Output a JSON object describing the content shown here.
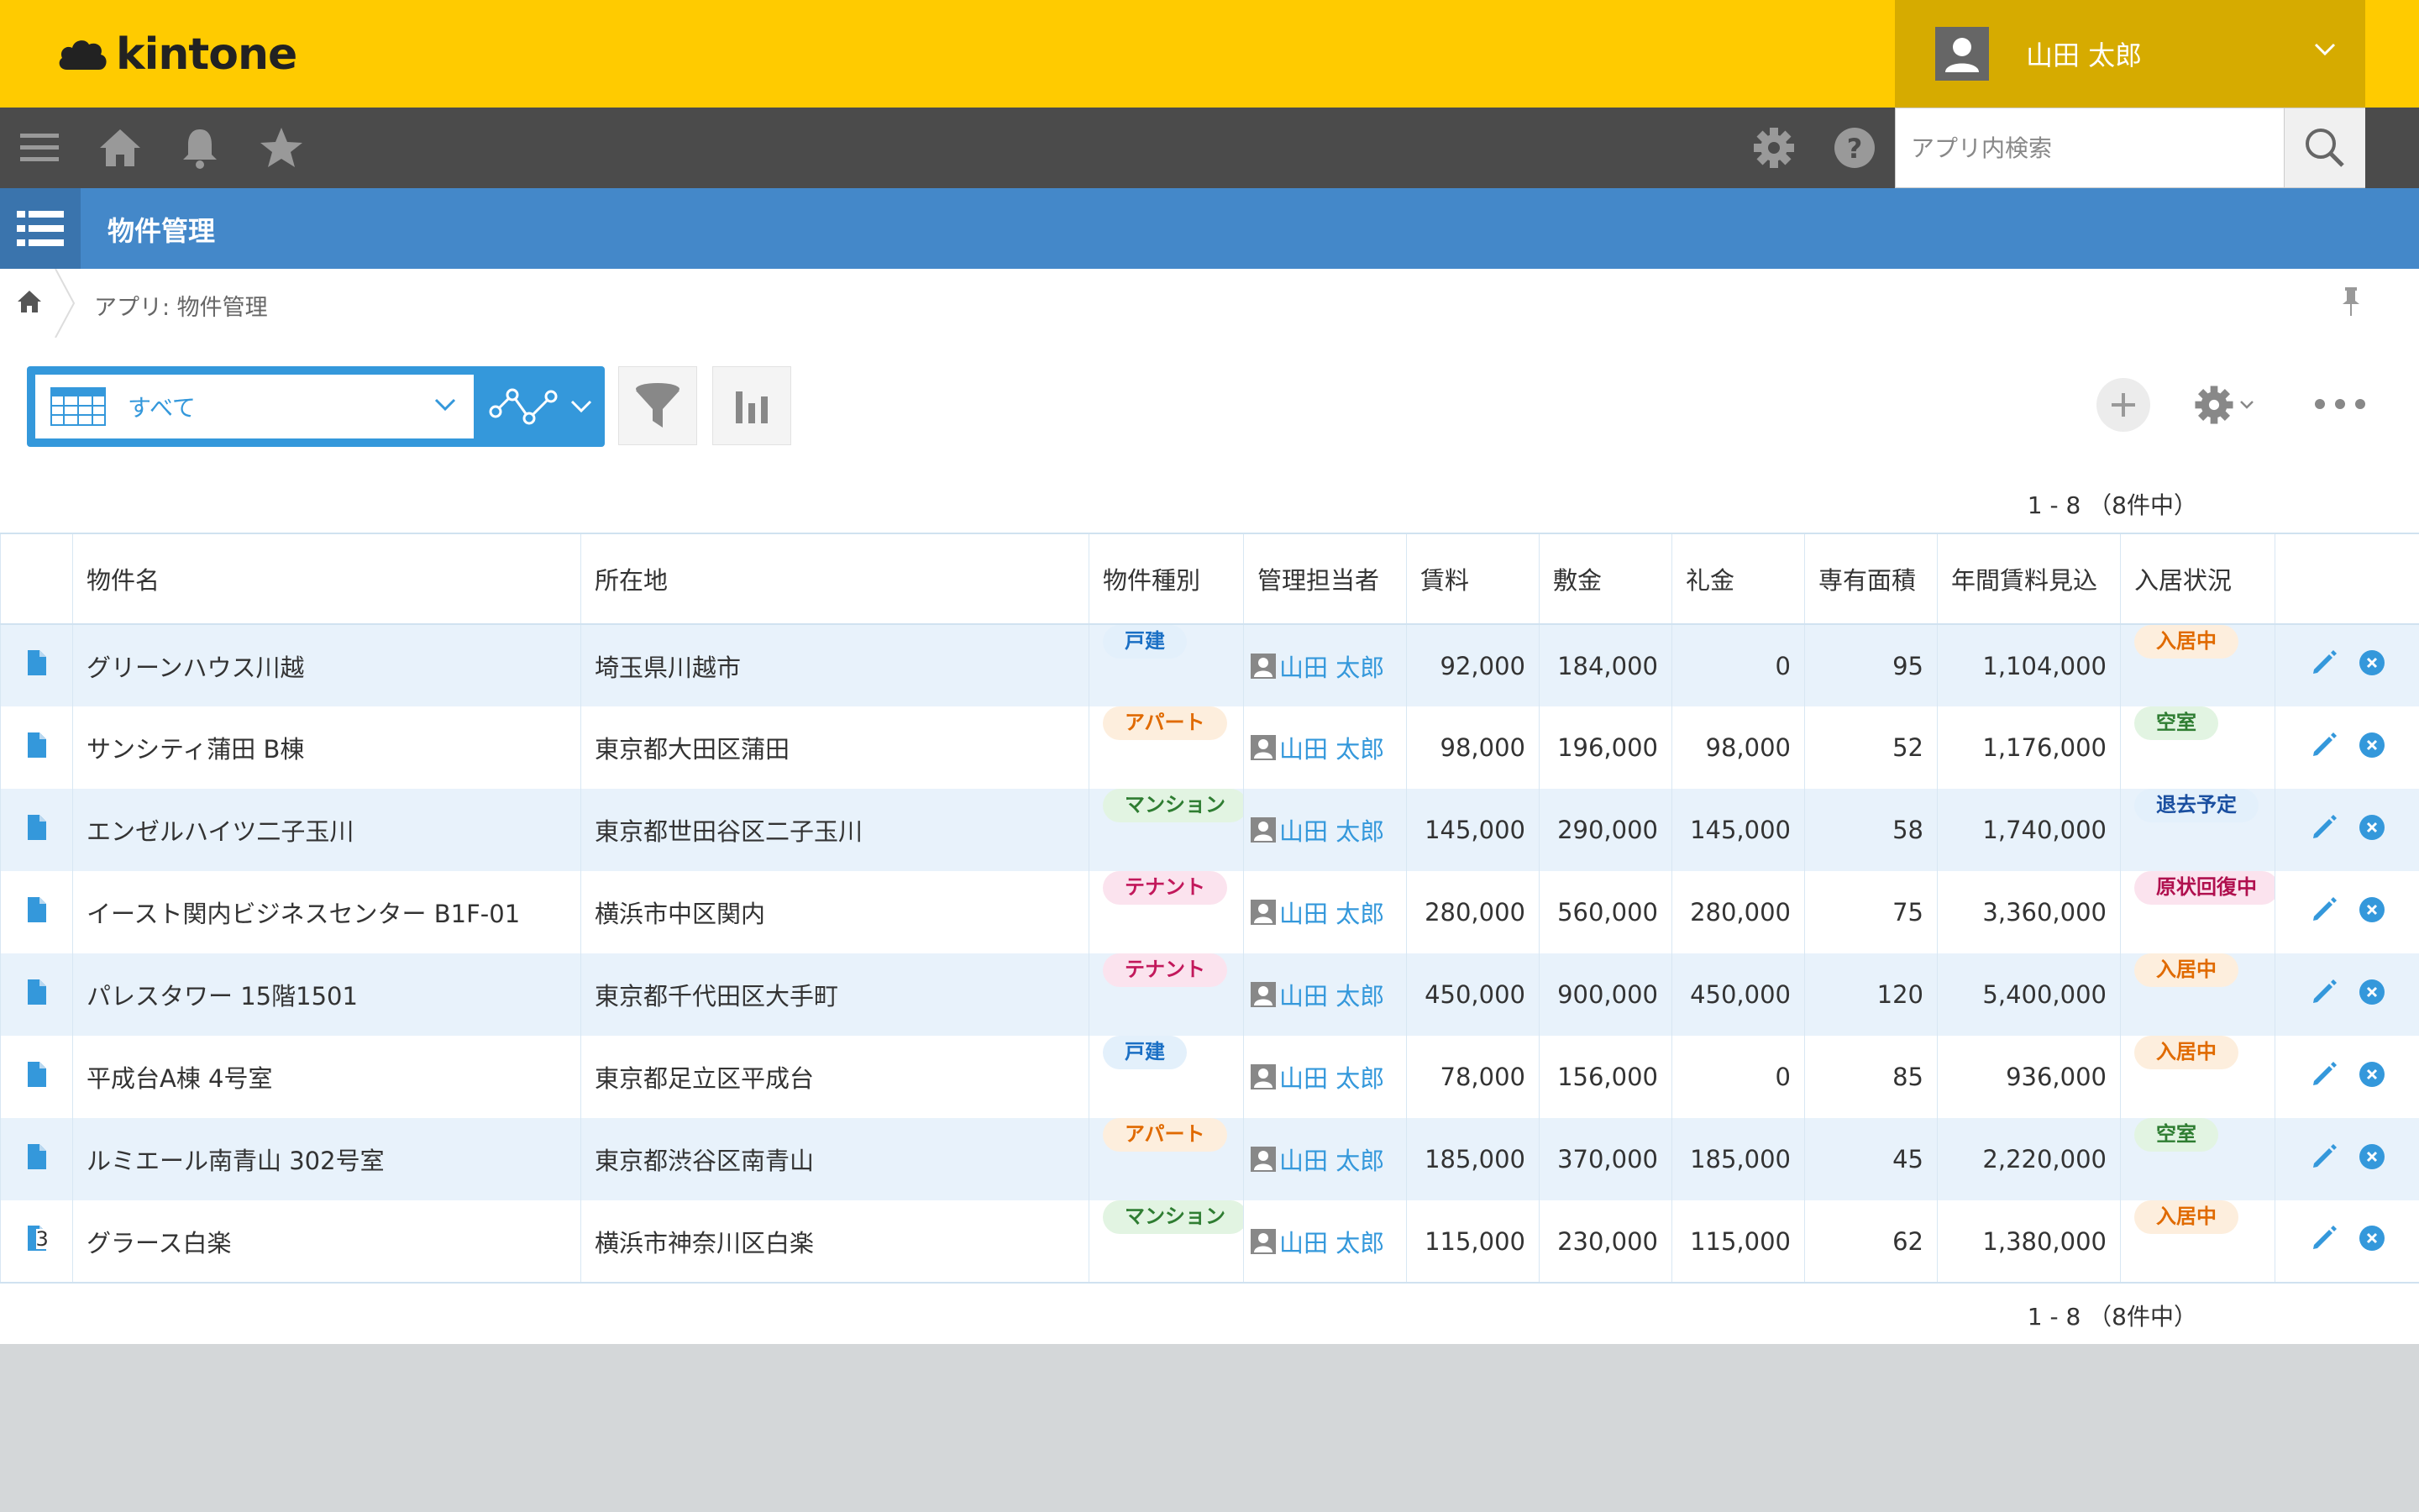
{
  "brand": {
    "name": "kintone",
    "color": "#ffcb00"
  },
  "user": {
    "name": "山田 太郎"
  },
  "nav": {
    "icons": [
      "menu-icon",
      "home-icon",
      "bell-icon",
      "star-icon"
    ],
    "right_icons": [
      "gear-icon",
      "help-icon"
    ],
    "search_placeholder": "アプリ内検索"
  },
  "app": {
    "title": "物件管理",
    "accent": "#4488c9"
  },
  "breadcrumb": {
    "text": "アプリ: 物件管理"
  },
  "toolbar": {
    "view_label": "すべて",
    "pager_top": "1 - 8 （8件中）",
    "pager_bottom": "1 - 8 （8件中）"
  },
  "table": {
    "headers": [
      "物件名",
      "所在地",
      "物件種別",
      "管理担当者",
      "賃料",
      "敷金",
      "礼金",
      "専有面積",
      "年間賃料見込",
      "入居状況"
    ],
    "rows": [
      {
        "name": "グリーンハウス川越",
        "address": "埼玉県川越市",
        "type": "戸建",
        "manager": "山田 太郎",
        "rent": "92,000",
        "deposit": "184,000",
        "key_money": "0",
        "area": "95",
        "annual": "1,104,000",
        "status": "入居中",
        "comments": ""
      },
      {
        "name": "サンシティ蒲田 B棟",
        "address": "東京都大田区蒲田",
        "type": "アパート",
        "manager": "山田 太郎",
        "rent": "98,000",
        "deposit": "196,000",
        "key_money": "98,000",
        "area": "52",
        "annual": "1,176,000",
        "status": "空室",
        "comments": ""
      },
      {
        "name": "エンゼルハイツ二子玉川",
        "address": "東京都世田谷区二子玉川",
        "type": "マンション",
        "manager": "山田 太郎",
        "rent": "145,000",
        "deposit": "290,000",
        "key_money": "145,000",
        "area": "58",
        "annual": "1,740,000",
        "status": "退去予定",
        "comments": ""
      },
      {
        "name": "イースト関内ビジネスセンター B1F-01",
        "address": "横浜市中区関内",
        "type": "テナント",
        "manager": "山田 太郎",
        "rent": "280,000",
        "deposit": "560,000",
        "key_money": "280,000",
        "area": "75",
        "annual": "3,360,000",
        "status": "原状回復中",
        "comments": ""
      },
      {
        "name": "パレスタワー 15階1501",
        "address": "東京都千代田区大手町",
        "type": "テナント",
        "manager": "山田 太郎",
        "rent": "450,000",
        "deposit": "900,000",
        "key_money": "450,000",
        "area": "120",
        "annual": "5,400,000",
        "status": "入居中",
        "comments": ""
      },
      {
        "name": "平成台A棟 4号室",
        "address": "東京都足立区平成台",
        "type": "戸建",
        "manager": "山田 太郎",
        "rent": "78,000",
        "deposit": "156,000",
        "key_money": "0",
        "area": "85",
        "annual": "936,000",
        "status": "入居中",
        "comments": ""
      },
      {
        "name": "ルミエール南青山 302号室",
        "address": "東京都渋谷区南青山",
        "type": "アパート",
        "manager": "山田 太郎",
        "rent": "185,000",
        "deposit": "370,000",
        "key_money": "185,000",
        "area": "45",
        "annual": "2,220,000",
        "status": "空室",
        "comments": ""
      },
      {
        "name": "グラース白楽",
        "address": "横浜市神奈川区白楽",
        "type": "マンション",
        "manager": "山田 太郎",
        "rent": "115,000",
        "deposit": "230,000",
        "key_money": "115,000",
        "area": "62",
        "annual": "1,380,000",
        "status": "入居中",
        "comments": "3"
      }
    ]
  },
  "badge_colors": {
    "戸建": {
      "bg": "#e3f0fb",
      "fg": "#1a6fc4"
    },
    "アパート": {
      "bg": "#fdeedd",
      "fg": "#e06a00"
    },
    "マンション": {
      "bg": "#e2f4e2",
      "fg": "#2f7d32"
    },
    "テナント": {
      "bg": "#fbe3ee",
      "fg": "#c2185b"
    },
    "入居中": {
      "bg": "#fdeedd",
      "fg": "#e06a00"
    },
    "空室": {
      "bg": "#e2f4e2",
      "fg": "#2f7d32"
    },
    "退去予定": {
      "bg": "#e3f0fb",
      "fg": "#1a4fa0"
    },
    "原状回復中": {
      "bg": "#fbe3ee",
      "fg": "#b0104e"
    }
  }
}
